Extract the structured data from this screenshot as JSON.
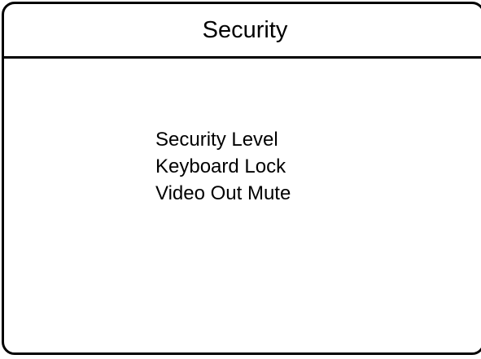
{
  "panel": {
    "title": "Security"
  },
  "menu": {
    "items": [
      {
        "label": "Security Level"
      },
      {
        "label": "Keyboard Lock"
      },
      {
        "label": "Video Out Mute"
      }
    ]
  }
}
